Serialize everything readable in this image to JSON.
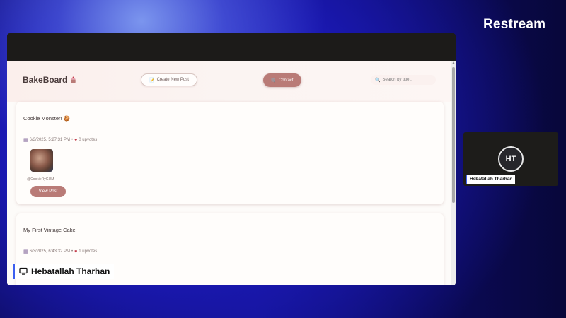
{
  "restream": {
    "brand": "Restream"
  },
  "app": {
    "logo": "BakeBoard",
    "create_button": "Create New Post",
    "contact_button": "Contact",
    "search_placeholder": "Search by title..."
  },
  "posts": [
    {
      "title": "Cookie Monster! 🍪",
      "date": "6/3/2025, 5:27:31 PM",
      "upvotes": "0 upvotes",
      "handle": "@CookieRyGUM",
      "view_button": "View Post"
    },
    {
      "title": "My First Vintage Cake",
      "date": "6/3/2025, 6:43:32 PM",
      "upvotes": "1 upvotes"
    }
  ],
  "presenter": {
    "name": "Hebatallah Tharhan"
  },
  "guest": {
    "initials": "HT",
    "name": "Hebatallah Tharhan"
  },
  "colors": {
    "accent": "#b97b77",
    "label_bar": "#3c5ff0"
  }
}
